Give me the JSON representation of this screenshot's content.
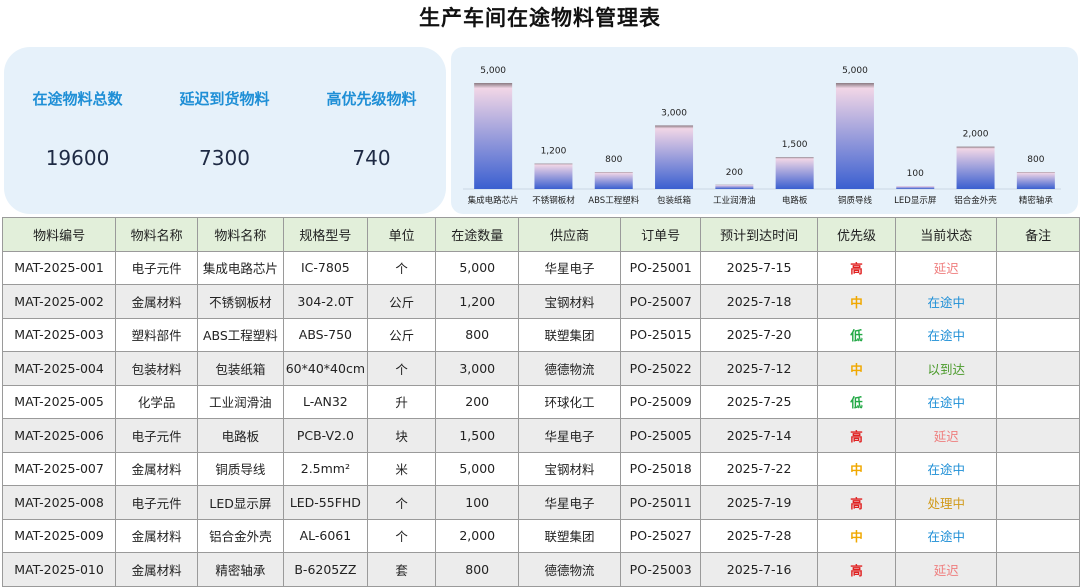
{
  "title": "生产车间在途物料管理表",
  "kpis": [
    {
      "label": "在途物料总数",
      "value": "19600"
    },
    {
      "label": "延迟到货物料",
      "value": "7300"
    },
    {
      "label": "高优先级物料",
      "value": "740"
    }
  ],
  "colors": {
    "accent": "#1f8fd6",
    "panel_bg": "#e6f1fa",
    "header_bg": "#e2efda",
    "bar_top": "#f1d6e6",
    "bar_bottom": "#3a5fd0",
    "priority_high": "#e02020",
    "priority_mid": "#f0a800",
    "priority_low": "#22a845"
  },
  "chart_data": {
    "type": "bar",
    "categories": [
      "集成电路芯片",
      "不锈钢板材",
      "ABS工程塑料",
      "包装纸箱",
      "工业润滑油",
      "电路板",
      "铜质导线",
      "LED显示屏",
      "铝合金外壳",
      "精密轴承"
    ],
    "values": [
      5000,
      1200,
      800,
      3000,
      200,
      1500,
      5000,
      100,
      2000,
      800
    ],
    "value_labels": [
      "5,000",
      "1,200",
      "800",
      "3,000",
      "200",
      "1,500",
      "5,000",
      "100",
      "2,000",
      "800"
    ],
    "ylim": [
      0,
      5000
    ],
    "grid": false,
    "legend": "none"
  },
  "table": {
    "headers": [
      "物料编号",
      "物料名称",
      "物料名称",
      "规格型号",
      "单位",
      "在途数量",
      "供应商",
      "订单号",
      "预计到达时间",
      "优先级",
      "当前状态",
      "备注"
    ],
    "rows": [
      {
        "id": "MAT-2025-001",
        "category": "电子元件",
        "name": "集成电路芯片",
        "spec": "IC-7805",
        "unit": "个",
        "qty": "5,000",
        "supplier": "华星电子",
        "order": "PO-25001",
        "eta": "2025-7-15",
        "priority": "高",
        "status": "延迟",
        "note": ""
      },
      {
        "id": "MAT-2025-002",
        "category": "金属材料",
        "name": "不锈钢板材",
        "spec": "304-2.0T",
        "unit": "公斤",
        "qty": "1,200",
        "supplier": "宝钢材料",
        "order": "PO-25007",
        "eta": "2025-7-18",
        "priority": "中",
        "status": "在途中",
        "note": ""
      },
      {
        "id": "MAT-2025-003",
        "category": "塑料部件",
        "name": "ABS工程塑料",
        "spec": "ABS-750",
        "unit": "公斤",
        "qty": "800",
        "supplier": "联塑集团",
        "order": "PO-25015",
        "eta": "2025-7-20",
        "priority": "低",
        "status": "在途中",
        "note": ""
      },
      {
        "id": "MAT-2025-004",
        "category": "包装材料",
        "name": "包装纸箱",
        "spec": "60*40*40cm",
        "unit": "个",
        "qty": "3,000",
        "supplier": "德德物流",
        "order": "PO-25022",
        "eta": "2025-7-12",
        "priority": "中",
        "status": "以到达",
        "note": ""
      },
      {
        "id": "MAT-2025-005",
        "category": "化学品",
        "name": "工业润滑油",
        "spec": "L-AN32",
        "unit": "升",
        "qty": "200",
        "supplier": "环球化工",
        "order": "PO-25009",
        "eta": "2025-7-25",
        "priority": "低",
        "status": "在途中",
        "note": ""
      },
      {
        "id": "MAT-2025-006",
        "category": "电子元件",
        "name": "电路板",
        "spec": "PCB-V2.0",
        "unit": "块",
        "qty": "1,500",
        "supplier": "华星电子",
        "order": "PO-25005",
        "eta": "2025-7-14",
        "priority": "高",
        "status": "延迟",
        "note": ""
      },
      {
        "id": "MAT-2025-007",
        "category": "金属材料",
        "name": "铜质导线",
        "spec": "2.5mm²",
        "unit": "米",
        "qty": "5,000",
        "supplier": "宝钢材料",
        "order": "PO-25018",
        "eta": "2025-7-22",
        "priority": "中",
        "status": "在途中",
        "note": ""
      },
      {
        "id": "MAT-2025-008",
        "category": "电子元件",
        "name": "LED显示屏",
        "spec": "LED-55FHD",
        "unit": "个",
        "qty": "100",
        "supplier": "华星电子",
        "order": "PO-25011",
        "eta": "2025-7-19",
        "priority": "高",
        "status": "处理中",
        "note": ""
      },
      {
        "id": "MAT-2025-009",
        "category": "金属材料",
        "name": "铝合金外壳",
        "spec": "AL-6061",
        "unit": "个",
        "qty": "2,000",
        "supplier": "联塑集团",
        "order": "PO-25027",
        "eta": "2025-7-28",
        "priority": "中",
        "status": "在途中",
        "note": ""
      },
      {
        "id": "MAT-2025-010",
        "category": "金属材料",
        "name": "精密轴承",
        "spec": "B-6205ZZ",
        "unit": "套",
        "qty": "800",
        "supplier": "德德物流",
        "order": "PO-25003",
        "eta": "2025-7-16",
        "priority": "高",
        "status": "延迟",
        "note": ""
      }
    ]
  }
}
